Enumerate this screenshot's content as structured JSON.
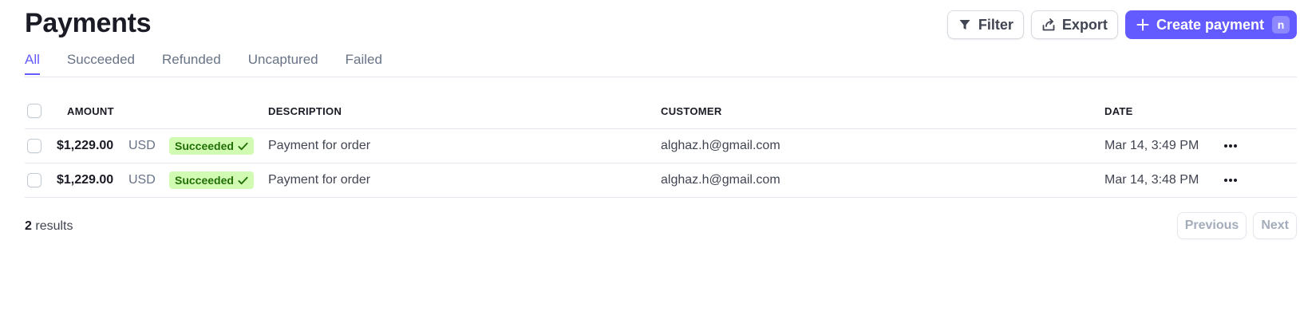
{
  "header": {
    "title": "Payments"
  },
  "toolbar": {
    "filter_label": "Filter",
    "export_label": "Export",
    "create_label": "Create payment",
    "create_shortcut": "n"
  },
  "tabs": [
    {
      "label": "All",
      "active": true
    },
    {
      "label": "Succeeded",
      "active": false
    },
    {
      "label": "Refunded",
      "active": false
    },
    {
      "label": "Uncaptured",
      "active": false
    },
    {
      "label": "Failed",
      "active": false
    }
  ],
  "table": {
    "columns": {
      "amount": "AMOUNT",
      "description": "DESCRIPTION",
      "customer": "CUSTOMER",
      "date": "DATE"
    },
    "rows": [
      {
        "amount": "$1,229.00",
        "currency": "USD",
        "status": "Succeeded",
        "description": "Payment for order",
        "customer": "alghaz.h@gmail.com",
        "date": "Mar 14, 3:49 PM"
      },
      {
        "amount": "$1,229.00",
        "currency": "USD",
        "status": "Succeeded",
        "description": "Payment for order",
        "customer": "alghaz.h@gmail.com",
        "date": "Mar 14, 3:48 PM"
      }
    ]
  },
  "footer": {
    "results_count": "2",
    "results_label": "results",
    "previous_label": "Previous",
    "next_label": "Next"
  },
  "colors": {
    "accent": "#635bff",
    "success_bg": "#d1fab3",
    "success_text": "#217005"
  },
  "icons": {
    "filter": "filter-icon",
    "export": "export-icon",
    "create": "plus-icon",
    "status": "checkmark-icon",
    "row_menu": "more-horizontal-icon"
  }
}
